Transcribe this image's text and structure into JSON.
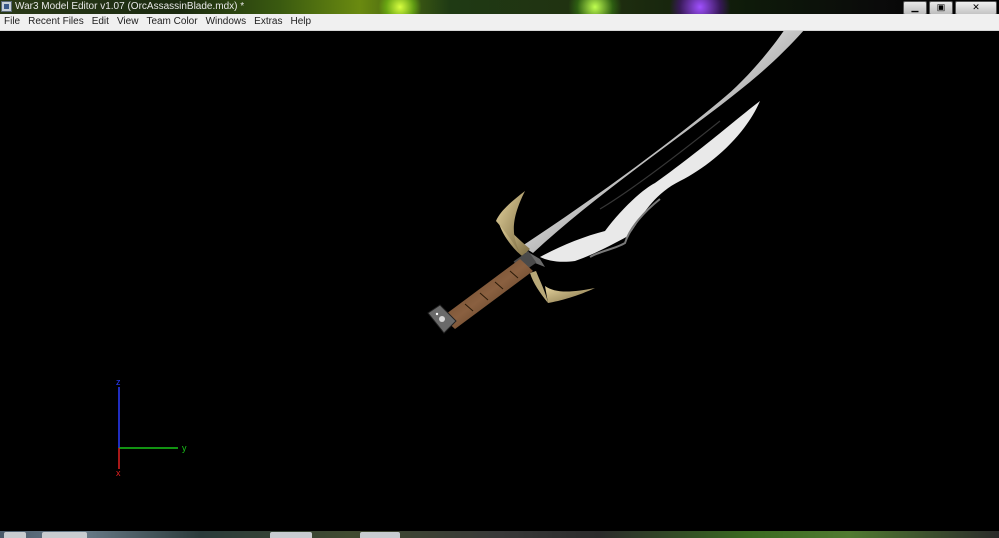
{
  "window": {
    "title": "War3 Model Editor v1.07 (OrcAssassinBlade.mdx) *",
    "minimize_label": "▁",
    "maximize_label": "▣",
    "close_label": "✕"
  },
  "menubar": {
    "items": [
      "File",
      "Recent Files",
      "Edit",
      "View",
      "Team Color",
      "Windows",
      "Extras",
      "Help"
    ]
  },
  "viewport": {
    "axes": {
      "z_label": "z",
      "y_label": "y",
      "x_label": "x"
    },
    "colors": {
      "z_axis": "#2a3cff",
      "y_axis": "#19c419",
      "x_axis": "#e02020",
      "background": "#000000"
    }
  },
  "icons": [
    "app-icon",
    "minimize-icon",
    "maximize-icon",
    "close-icon"
  ]
}
